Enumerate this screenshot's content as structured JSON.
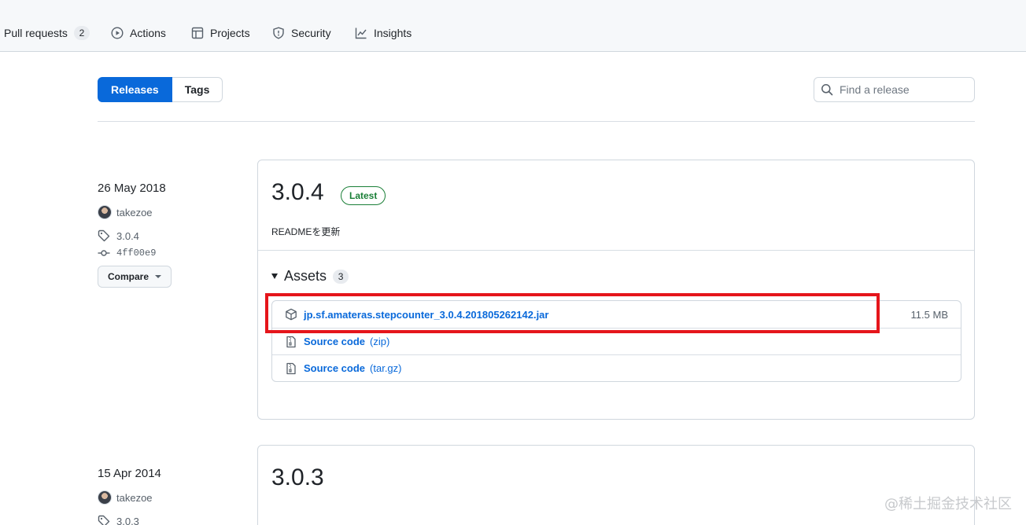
{
  "nav": {
    "items": [
      {
        "label": "Pull requests",
        "count": "2"
      },
      {
        "label": "Actions"
      },
      {
        "label": "Projects"
      },
      {
        "label": "Security"
      },
      {
        "label": "Insights"
      }
    ]
  },
  "subnav": {
    "releases_label": "Releases",
    "tags_label": "Tags"
  },
  "search": {
    "placeholder": "Find a release"
  },
  "releases": [
    {
      "date": "26 May 2018",
      "author": "takezoe",
      "tag": "3.0.4",
      "commit": "4ff00e9",
      "compare_label": "Compare",
      "version": "3.0.4",
      "badge": "Latest",
      "notes": "READMEを更新",
      "assets_label": "Assets",
      "assets_count": "3",
      "assets": [
        {
          "name": "jp.sf.amateras.stepcounter_3.0.4.201805262142.jar",
          "size": "11.5 MB"
        },
        {
          "name": "Source code",
          "ext": "(zip)"
        },
        {
          "name": "Source code",
          "ext": "(tar.gz)"
        }
      ]
    },
    {
      "date": "15 Apr 2014",
      "author": "takezoe",
      "tag": "3.0.3",
      "version": "3.0.3"
    }
  ],
  "watermark": "@稀土掘金技术社区",
  "colors": {
    "accent": "#0969da",
    "latest_badge": "#1a7f37",
    "highlight_box": "#e5151b"
  }
}
